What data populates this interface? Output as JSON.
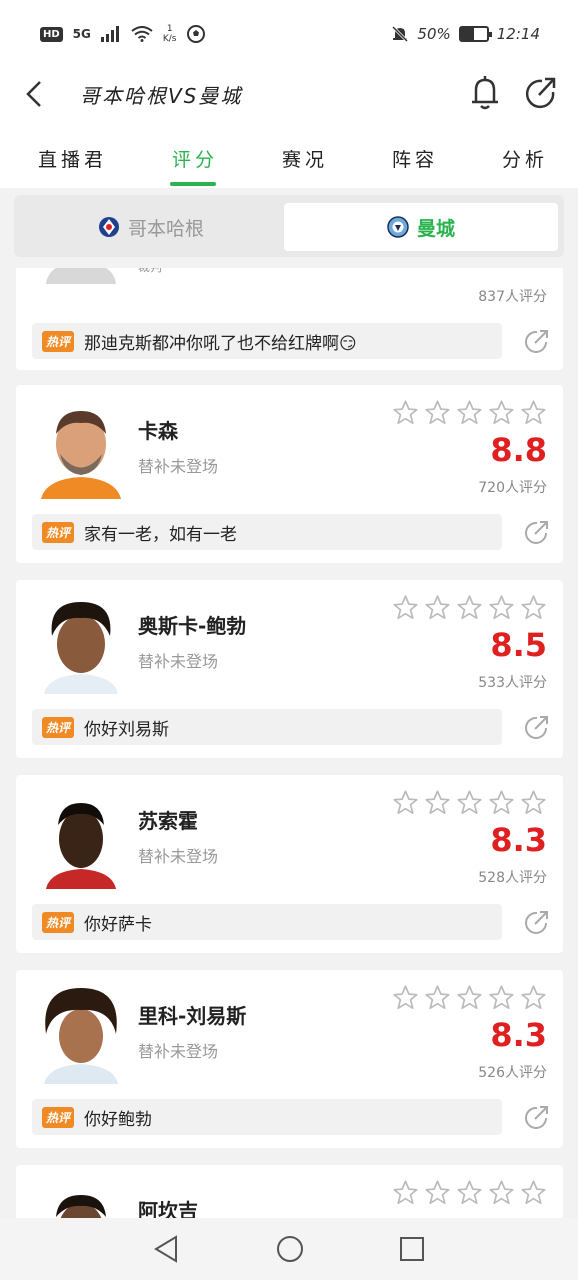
{
  "status_bar": {
    "hd": "HD",
    "network": "5G",
    "speed_top": "1",
    "speed_unit": "K/s",
    "battery_pct": "50%",
    "battery_fill": 0.5,
    "time": "12:14"
  },
  "header": {
    "title": "哥本哈根VS曼城"
  },
  "tabs": [
    {
      "label": "直播君"
    },
    {
      "label": "评分"
    },
    {
      "label": "赛况"
    },
    {
      "label": "阵容"
    },
    {
      "label": "分析"
    }
  ],
  "teams": {
    "left": "哥本哈根",
    "right": "曼城"
  },
  "colors": {
    "accent": "#2bb34f",
    "score": "#e02020",
    "hot": "#f08a24"
  },
  "partial_card": {
    "name_fragment": "裁判",
    "raters": "837人评分",
    "hot_label": "热评",
    "comment": "那迪克斯都冲你吼了也不给红牌啊😏"
  },
  "players": [
    {
      "name": "卡森",
      "status": "替补未登场",
      "score": "8.8",
      "raters": "720人评分",
      "hot_label": "热评",
      "comment": "家有一老，如有一老"
    },
    {
      "name": "奥斯卡-鲍勃",
      "status": "替补未登场",
      "score": "8.5",
      "raters": "533人评分",
      "hot_label": "热评",
      "comment": "你好刘易斯"
    },
    {
      "name": "苏索霍",
      "status": "替补未登场",
      "score": "8.3",
      "raters": "528人评分",
      "hot_label": "热评",
      "comment": "你好萨卡"
    },
    {
      "name": "里科-刘易斯",
      "status": "替补未登场",
      "score": "8.3",
      "raters": "526人评分",
      "hot_label": "热评",
      "comment": "你好鲍勃"
    },
    {
      "name": "阿坎吉"
    }
  ]
}
